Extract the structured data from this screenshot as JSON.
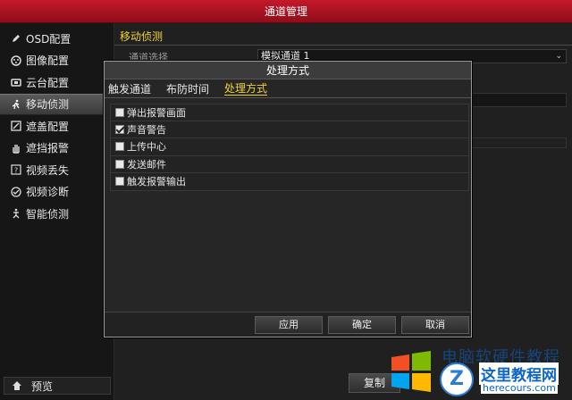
{
  "window": {
    "title": "通道管理"
  },
  "sidebar": {
    "items": [
      {
        "label": "OSD配置",
        "icon": "edit-icon",
        "active": false
      },
      {
        "label": "图像配置",
        "icon": "palette-icon",
        "active": false
      },
      {
        "label": "云台配置",
        "icon": "ptz-icon",
        "active": false
      },
      {
        "label": "移动侦测",
        "icon": "running-man-icon",
        "active": true
      },
      {
        "label": "遮盖配置",
        "icon": "mask-icon",
        "active": false
      },
      {
        "label": "遮挡报警",
        "icon": "hand-icon",
        "active": false
      },
      {
        "label": "视频丢失",
        "icon": "question-icon",
        "active": false
      },
      {
        "label": "视频诊断",
        "icon": "diagnosis-icon",
        "active": false
      },
      {
        "label": "智能侦测",
        "icon": "smart-detect-icon",
        "active": false
      }
    ],
    "preview_label": "预览"
  },
  "main": {
    "tab_label": "移动侦测",
    "channel_label": "通道选择",
    "channel_value": "模拟通道 1",
    "background_button_label": "复制"
  },
  "modal": {
    "title": "处理方式",
    "tabs": [
      {
        "label": "触发通道",
        "active": false
      },
      {
        "label": "布防时间",
        "active": false
      },
      {
        "label": "处理方式",
        "active": true
      }
    ],
    "options": [
      {
        "label": "弹出报警画面",
        "checked": false
      },
      {
        "label": "声音警告",
        "checked": true
      },
      {
        "label": "上传中心",
        "checked": false
      },
      {
        "label": "发送邮件",
        "checked": false
      },
      {
        "label": "触发报警输出",
        "checked": false
      }
    ],
    "buttons": {
      "apply": "应用",
      "ok": "确定",
      "cancel": "取消"
    }
  },
  "watermark": {
    "faint_text": "电脑软硬件教程网",
    "site_title": "这里教程网",
    "site_url": "herecours.com",
    "badge_letter": "Z"
  },
  "colors": {
    "title_bar": "#b01424",
    "accent": "#f2d23a",
    "active_item": "#4a4a4a"
  }
}
